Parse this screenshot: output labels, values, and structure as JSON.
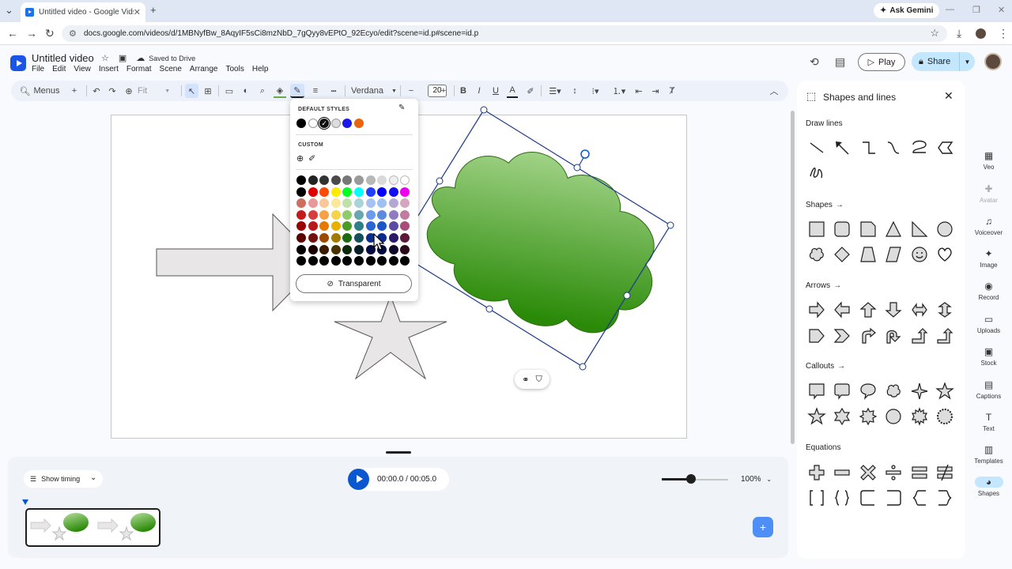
{
  "browser": {
    "tab_title": "Untitled video - Google Vids",
    "ask_gemini": "Ask Gemini",
    "url": "docs.google.com/videos/d/1MBNyfBw_8AqyIF5sCi8mzNbD_7gQyy8vEPtO_92Ecyo/edit?scene=id.p#scene=id.p"
  },
  "app": {
    "title": "Untitled video",
    "saved_status": "Saved to Drive",
    "menus": [
      "File",
      "Edit",
      "View",
      "Insert",
      "Format",
      "Scene",
      "Arrange",
      "Tools",
      "Help"
    ],
    "play_label": "Play",
    "share_label": "Share"
  },
  "toolbar": {
    "menus_label": "Menus",
    "zoom_label": "Fit",
    "font_name": "Verdana",
    "font_size": "20"
  },
  "color_popup": {
    "default_heading": "DEFAULT STYLES",
    "custom_heading": "CUSTOM",
    "transparent_label": "Transparent",
    "default_colors": [
      "#000000",
      "#ffffff",
      "#111111",
      "#dddddd",
      "#1a1ae6",
      "#e8650f"
    ],
    "grid_rows": [
      [
        "#000000",
        "#222222",
        "#333333",
        "#4a4a4a",
        "#777777",
        "#999999",
        "#b7b7b7",
        "#d9d9d9",
        "#efefef",
        "#ffffff"
      ],
      [
        "#000000",
        "#e00000",
        "#ff4a00",
        "#ffea00",
        "#00ff22",
        "#00ffff",
        "#2040ff",
        "#0000ff",
        "#1010ee",
        "#ee00ee"
      ],
      [
        "#cc6f5f",
        "#e89898",
        "#f9c89a",
        "#fce79d",
        "#bfe1a9",
        "#a8d3d9",
        "#a6c3ef",
        "#9fc0f3",
        "#b4a7d6",
        "#d5a6bd"
      ],
      [
        "#c41a1a",
        "#d83d3d",
        "#f6a145",
        "#f7d24b",
        "#8fca6c",
        "#68a7b1",
        "#6b9cec",
        "#5b8ae0",
        "#8e7cc3",
        "#c27ba0"
      ],
      [
        "#990000",
        "#b61a1a",
        "#e67a00",
        "#e8b100",
        "#4a9a28",
        "#2f7f89",
        "#2b65d2",
        "#1c55c8",
        "#5c4aa5",
        "#a64d79"
      ],
      [
        "#5c0000",
        "#731010",
        "#9c4a00",
        "#a37a00",
        "#1a6a10",
        "#134f5c",
        "#0a2e8a",
        "#0a2a90",
        "#2a1a6a",
        "#5c1a3a"
      ],
      [
        "#000000",
        "#1a0000",
        "#3a1a00",
        "#4a3200",
        "#0a2a0a",
        "#061f26",
        "#020c40",
        "#000a40",
        "#0f0a2a",
        "#2a0a1a"
      ],
      [
        "#000000",
        "#000000",
        "#000000",
        "#000000",
        "#000000",
        "#000000",
        "#000000",
        "#000000",
        "#000000",
        "#000000"
      ]
    ]
  },
  "right_panel": {
    "title": "Shapes and lines",
    "draw_lines": "Draw lines",
    "shapes": "Shapes",
    "arrows": "Arrows",
    "callouts": "Callouts",
    "equations": "Equations"
  },
  "rail": [
    {
      "label": "Veo",
      "icon": "veo-icon"
    },
    {
      "label": "Avatar",
      "icon": "avatar-icon"
    },
    {
      "label": "Voiceover",
      "icon": "voiceover-icon"
    },
    {
      "label": "Image",
      "icon": "image-icon"
    },
    {
      "label": "Record",
      "icon": "record-icon"
    },
    {
      "label": "Uploads",
      "icon": "uploads-icon"
    },
    {
      "label": "Stock",
      "icon": "stock-icon"
    },
    {
      "label": "Captions",
      "icon": "captions-icon"
    },
    {
      "label": "Text",
      "icon": "text-icon"
    },
    {
      "label": "Templates",
      "icon": "templates-icon"
    },
    {
      "label": "Shapes",
      "icon": "shapes-icon"
    }
  ],
  "timeline": {
    "show_timing": "Show timing",
    "timecode": "00:00.0 / 00:05.0",
    "zoom": "100%",
    "zoom_level": 0.44
  },
  "colors": {
    "accent": "#0b57d0",
    "cloud_light": "#a8d88a",
    "cloud_dark": "#2a8a08",
    "shape_fill": "#e8e6e6"
  }
}
